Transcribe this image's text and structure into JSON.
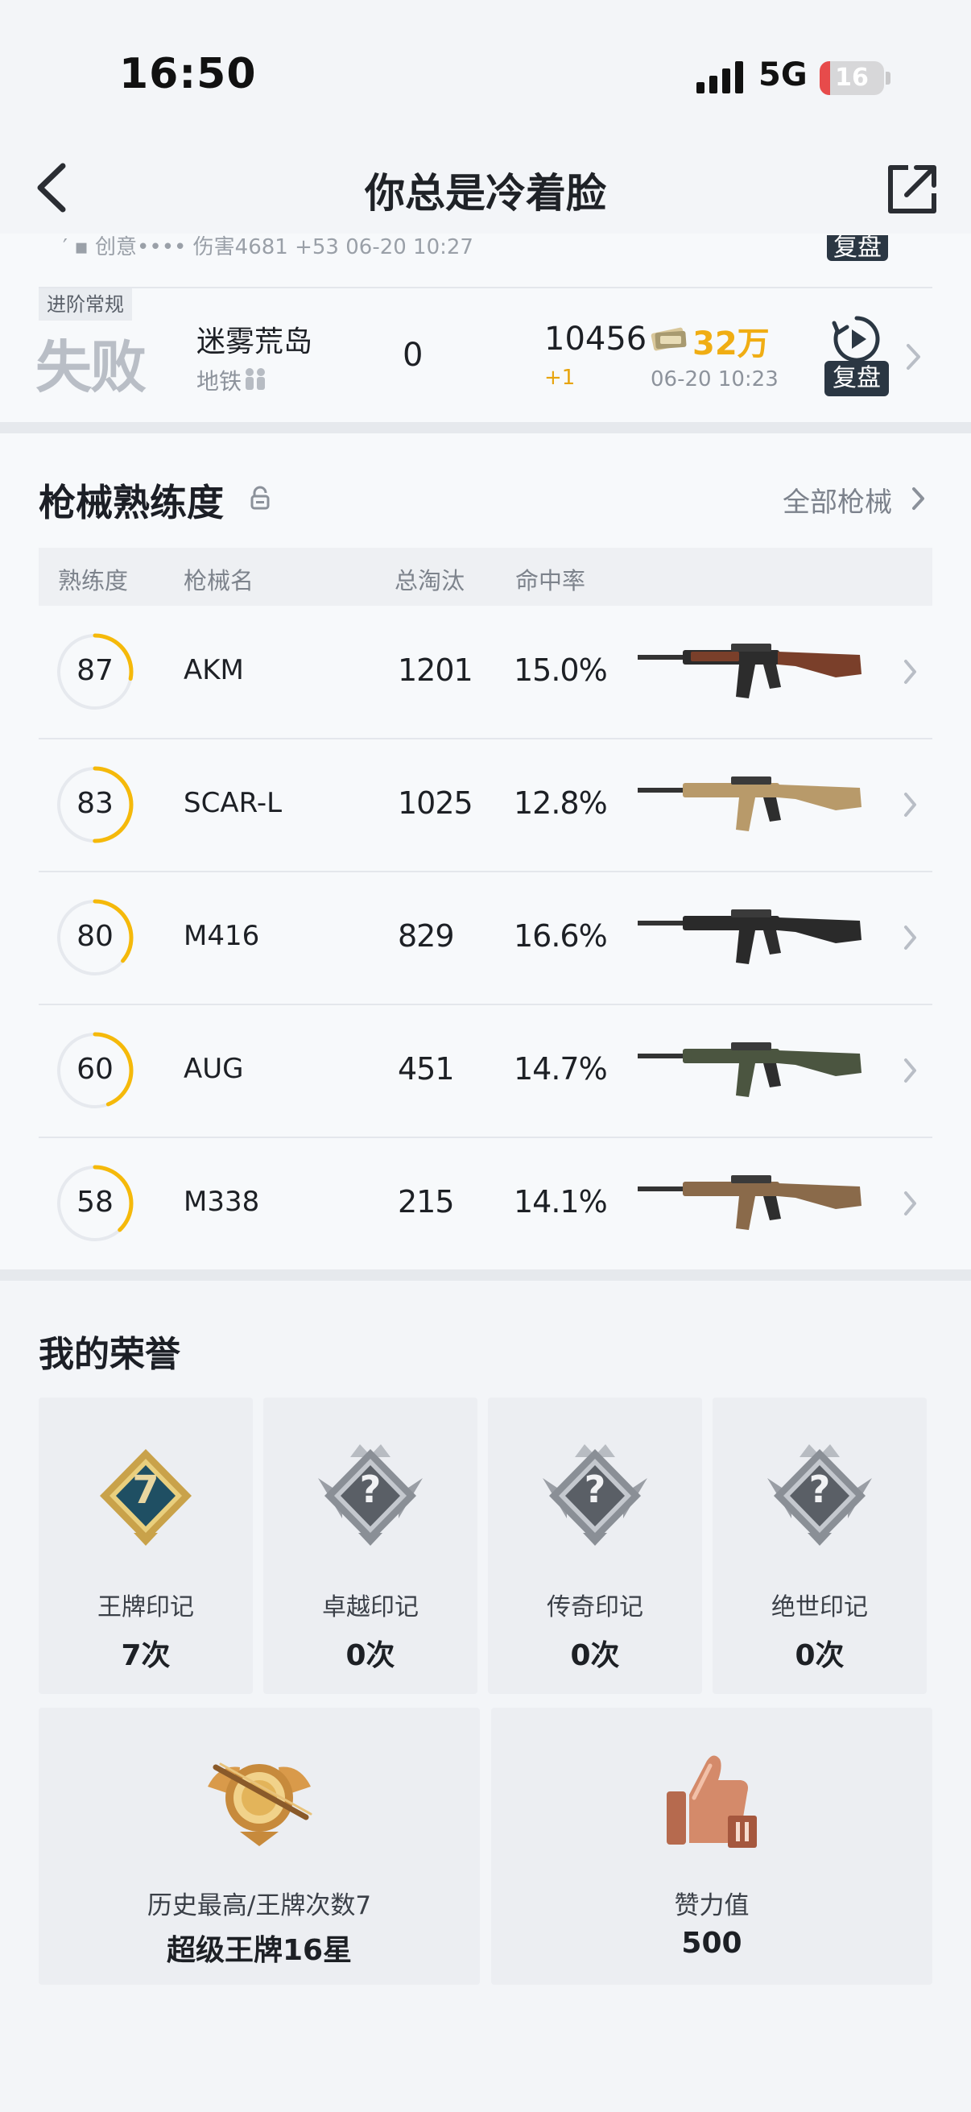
{
  "status_bar": {
    "time": "16:50",
    "network": "5G",
    "battery": "16",
    "battery_color": "#e74b4b"
  },
  "nav": {
    "title": "你总是冷着脸",
    "back_icon": "chevron-left-icon",
    "share_icon": "share-icon"
  },
  "matches": {
    "previous_row": {
      "clipped_text": "′ ▪       创意••••       伤害4681       +53       06-20 10:27",
      "replay_label": "复盘"
    },
    "rows": [
      {
        "mode": "进阶常规",
        "result": "失败",
        "map": "迷雾荒岛",
        "sub": "地铁",
        "kills": "0",
        "score": "10456",
        "score_delta": "+1",
        "reward": "32万",
        "date": "06-20 10:23",
        "replay_label": "复盘"
      }
    ]
  },
  "weapon_mastery": {
    "title": "枪械熟练度",
    "all_link": "全部枪械",
    "columns": [
      "熟练度",
      "枪械名",
      "总淘汰",
      "命中率"
    ],
    "accent": "#f5b90a",
    "weapons": [
      {
        "level": "87",
        "progress": 0.28,
        "name": "AKM",
        "kills": "1201",
        "accuracy": "15.0%",
        "wood": true,
        "color": "#2c2c2c"
      },
      {
        "level": "83",
        "progress": 0.5,
        "name": "SCAR-L",
        "kills": "1025",
        "accuracy": "12.8%",
        "wood": false,
        "color": "#b89a6a"
      },
      {
        "level": "80",
        "progress": 0.36,
        "name": "M416",
        "kills": "829",
        "accuracy": "16.6%",
        "wood": false,
        "color": "#2a2a2a"
      },
      {
        "level": "60",
        "progress": 0.44,
        "name": "AUG",
        "kills": "451",
        "accuracy": "14.7%",
        "wood": false,
        "color": "#4b5540"
      },
      {
        "level": "58",
        "progress": 0.38,
        "name": "M338",
        "kills": "215",
        "accuracy": "14.1%",
        "wood": false,
        "color": "#8a6a4a"
      }
    ]
  },
  "honors": {
    "title": "我的荣誉",
    "items": [
      {
        "label": "王牌印记",
        "count": "7次",
        "badge": "7",
        "icon": "ace-mark-medal-icon"
      },
      {
        "label": "卓越印记",
        "count": "0次",
        "badge": "?",
        "icon": "excellence-mark-medal-icon"
      },
      {
        "label": "传奇印记",
        "count": "0次",
        "badge": "?",
        "icon": "legend-mark-medal-icon"
      },
      {
        "label": "绝世印记",
        "count": "0次",
        "badge": "?",
        "icon": "peerless-mark-medal-icon"
      }
    ],
    "history": {
      "label": "历史最高/王牌次数7",
      "value": "超级王牌16星",
      "icon": "rank-emblem-icon"
    },
    "likes": {
      "label": "赞力值",
      "value": "500",
      "icon": "thumbs-up-icon"
    }
  }
}
